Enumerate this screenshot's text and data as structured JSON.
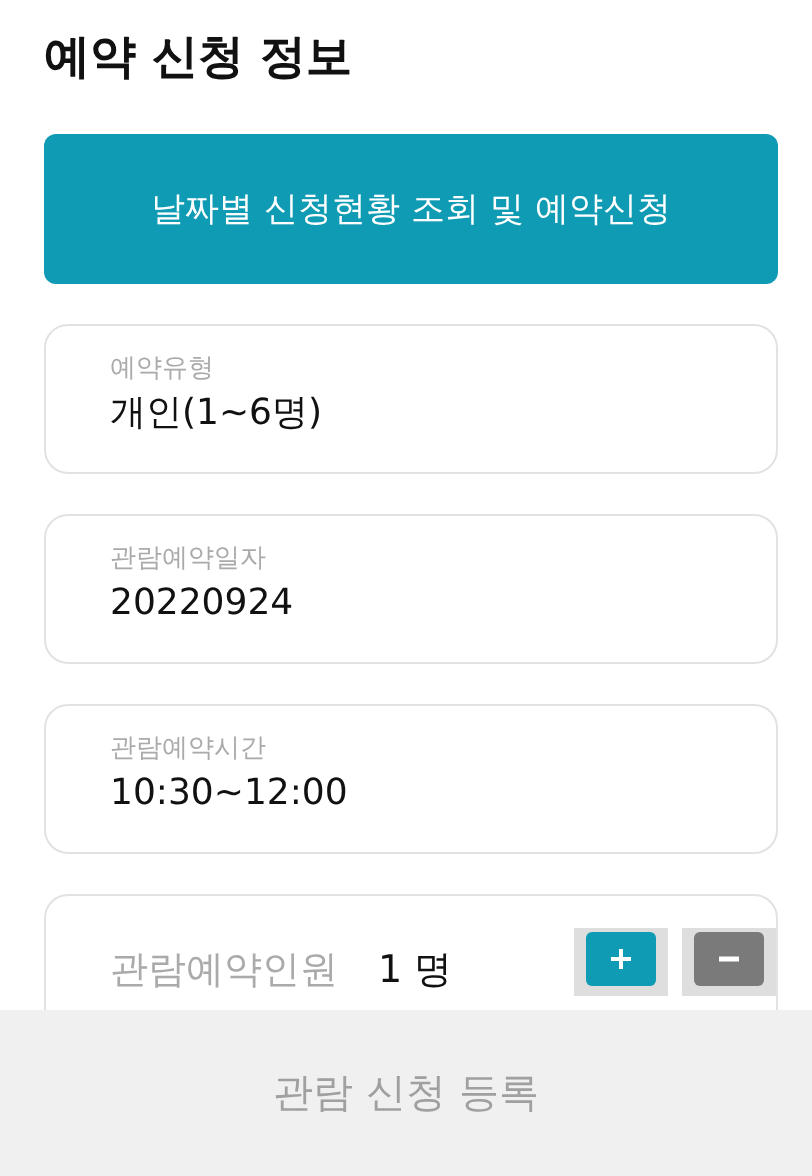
{
  "title": "예약 신청 정보",
  "lookup_button": {
    "label": "날짜별 신청현황 조회 및 예약신청"
  },
  "fields": [
    {
      "label": "예약유형",
      "value": "개인(1~6명)"
    },
    {
      "label": "관람예약일자",
      "value": "20220924"
    },
    {
      "label": "관람예약시간",
      "value": "10:30~12:00"
    }
  ],
  "people": {
    "label": "관람예약인원",
    "count": "1 명"
  },
  "submit_button": {
    "label": "관람 신청 등록",
    "disabled": true
  }
}
